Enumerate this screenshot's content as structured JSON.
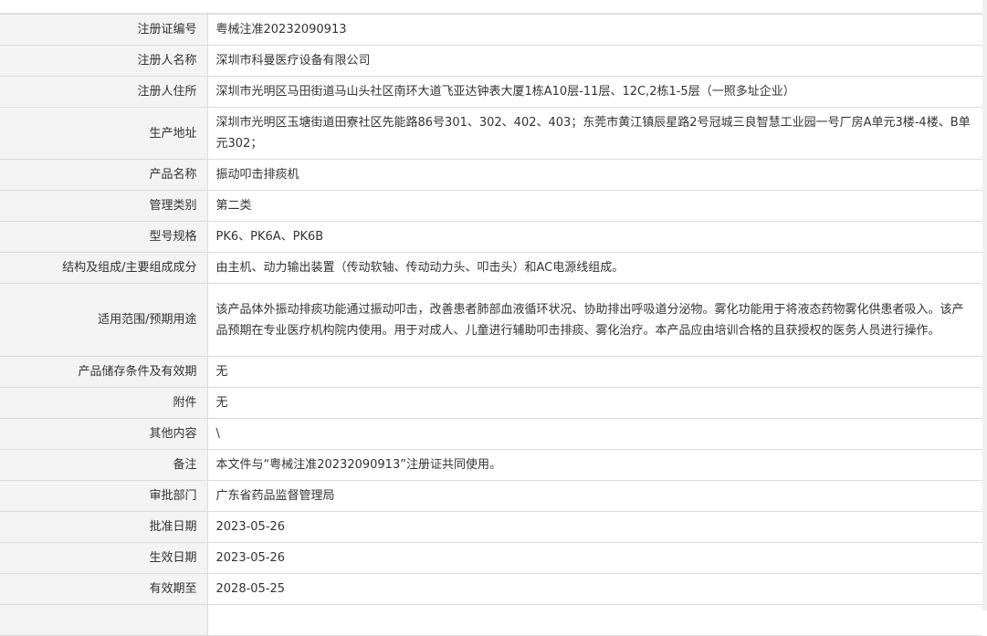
{
  "rows": [
    {
      "label": "注册证编号",
      "value": "粤械注准20232090913"
    },
    {
      "label": "注册人名称",
      "value": "深圳市科曼医疗设备有限公司"
    },
    {
      "label": "注册人住所",
      "value": "深圳市光明区马田街道马山头社区南环大道飞亚达钟表大厦1栋A10层-11层、12C,2栋1-5层（一照多址企业）"
    },
    {
      "label": "生产地址",
      "value": "深圳市光明区玉塘街道田寮社区先能路86号301、302、402、403；东莞市黄江镇辰星路2号冠城三良智慧工业园一号厂房A单元3楼-4楼、B单元302；"
    },
    {
      "label": "产品名称",
      "value": "振动叩击排痰机"
    },
    {
      "label": "管理类别",
      "value": "第二类"
    },
    {
      "label": "型号规格",
      "value": "PK6、PK6A、PK6B"
    },
    {
      "label": "结构及组成/主要组成成分",
      "value": "由主机、动力输出装置（传动软轴、传动动力头、叩击头）和AC电源线组成。"
    },
    {
      "label": "适用范围/预期用途",
      "value": "该产品体外振动排痰功能通过振动叩击，改善患者肺部血液循环状况、协助排出呼吸道分泌物。雾化功能用于将液态药物雾化供患者吸入。该产品预期在专业医疗机构院内使用。用于对成人、儿童进行辅助叩击排痰、雾化治疗。本产品应由培训合格的且获授权的医务人员进行操作。"
    },
    {
      "label": "产品储存条件及有效期",
      "value": "无"
    },
    {
      "label": "附件",
      "value": "无"
    },
    {
      "label": "其他内容",
      "value": "\\"
    },
    {
      "label": "备注",
      "value": "本文件与“粤械注准20232090913”注册证共同使用。"
    },
    {
      "label": "审批部门",
      "value": "广东省药品监督管理局"
    },
    {
      "label": "批准日期",
      "value": "2023-05-26"
    },
    {
      "label": "生效日期",
      "value": "2023-05-26"
    },
    {
      "label": "有效期至",
      "value": "2028-05-25"
    }
  ]
}
